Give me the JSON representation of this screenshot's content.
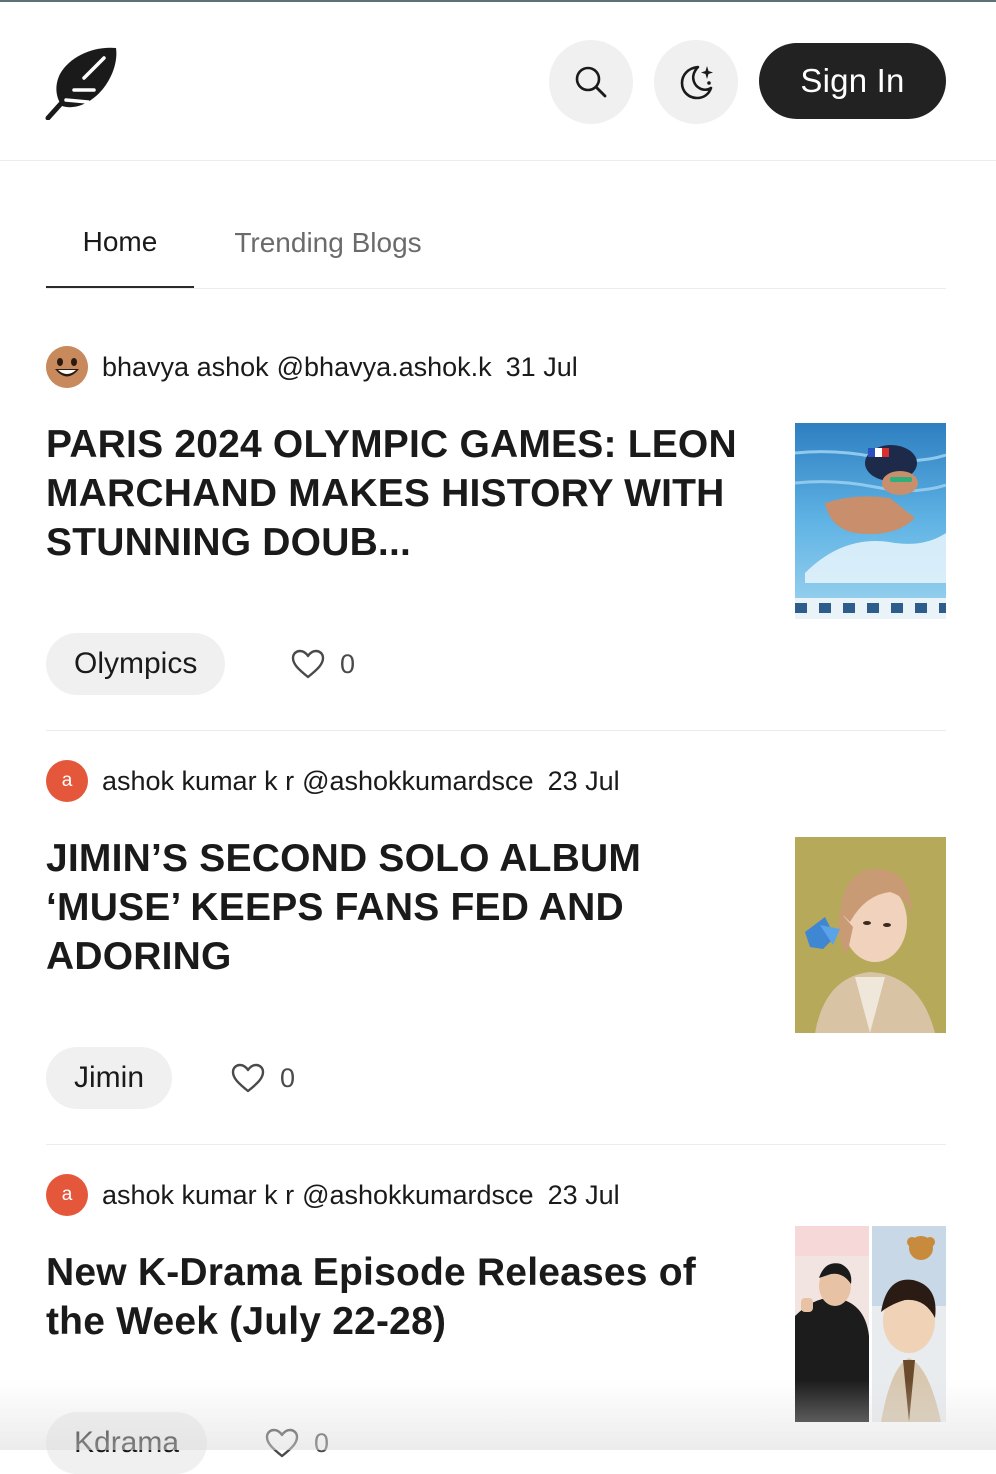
{
  "header": {
    "logo_icon": "feather-logo-icon",
    "search_icon": "search-icon",
    "theme_icon": "moon-sparkle-icon",
    "signin_label": "Sign In"
  },
  "tabs": [
    {
      "label": "Home",
      "active": true
    },
    {
      "label": "Trending Blogs",
      "active": false
    }
  ],
  "posts": [
    {
      "author_name": "bhavya ashok",
      "author_handle": "@bhavya.ashok.k",
      "avatar": "smiling-face-avatar",
      "date": "31 Jul",
      "title": "PARIS 2024 OLYMPIC GAMES: LEON MARCHAND MAKES HISTORY WITH STUNNING DOUB...",
      "thumbnail": "swimmer-in-pool-photo",
      "tag": "Olympics",
      "likes": "0"
    },
    {
      "author_name": "ashok kumar k r",
      "author_handle": "@ashokkumardsce",
      "avatar_letter": "a",
      "date": "23 Jul",
      "title": "JIMIN’S SECOND SOLO ALBUM ‘MUSE’ KEEPS FANS FED AND ADORING",
      "thumbnail": "jimin-portrait-photo",
      "tag": "Jimin",
      "likes": "0"
    },
    {
      "author_name": "ashok kumar k r",
      "author_handle": "@ashokkumardsce",
      "avatar_letter": "a",
      "date": "23 Jul",
      "title": "New K-Drama Episode Releases of the Week (July 22-28)",
      "thumbnail": "kdrama-actors-photo",
      "tag": "Kdrama",
      "likes": "0"
    }
  ],
  "colors": {
    "accent_dark": "#222222",
    "avatar_orange": "#e5573a",
    "pill_bg": "#f0f0f0"
  }
}
